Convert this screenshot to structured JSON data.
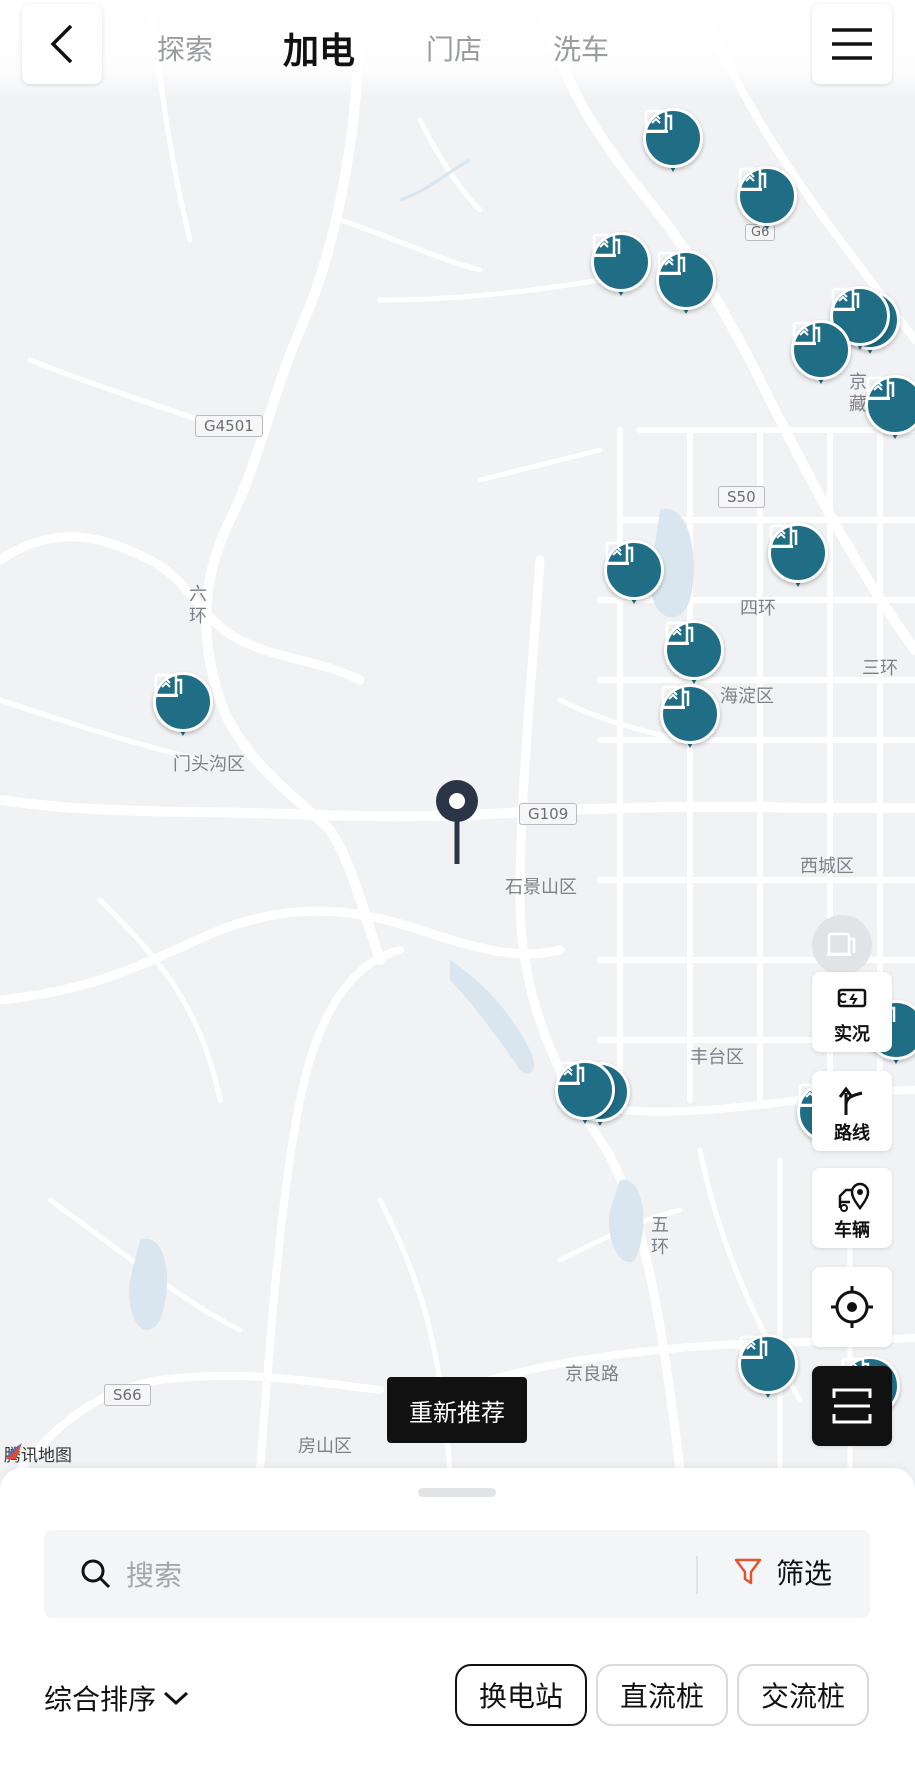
{
  "header": {
    "back_icon": "chevron-left-icon",
    "menu_icon": "hamburger-menu-icon",
    "tabs": [
      {
        "label": "探索",
        "active": false
      },
      {
        "label": "加电",
        "active": true
      },
      {
        "label": "门店",
        "active": false
      },
      {
        "label": "洗车",
        "active": false
      }
    ]
  },
  "map": {
    "road_labels": [
      "G4501",
      "S50",
      "G109",
      "S66",
      "G6"
    ],
    "place_labels": [
      "门头沟区",
      "石景山区",
      "海淀区",
      "西城区",
      "丰台区",
      "房山区",
      "京良路",
      "四环",
      "三环"
    ],
    "vertical_labels": [
      "六环",
      "五环",
      "京藏"
    ],
    "attribution": "腾讯地图",
    "station_icon": "charging-station-icon",
    "location_pin_icon": "map-pin-icon",
    "accent_color": "#1f6e86"
  },
  "controls": {
    "live": "实况",
    "route": "路线",
    "vehicle": "车辆",
    "locate_icon": "crosshair-locate-icon",
    "scan_icon": "scan-icon",
    "recommend": "重新推荐"
  },
  "sheet": {
    "search_placeholder": "搜索",
    "filter": "筛选",
    "sort": "综合排序",
    "chips": [
      {
        "label": "换电站",
        "active": true
      },
      {
        "label": "直流桩",
        "active": false
      },
      {
        "label": "交流桩",
        "active": false
      }
    ]
  }
}
